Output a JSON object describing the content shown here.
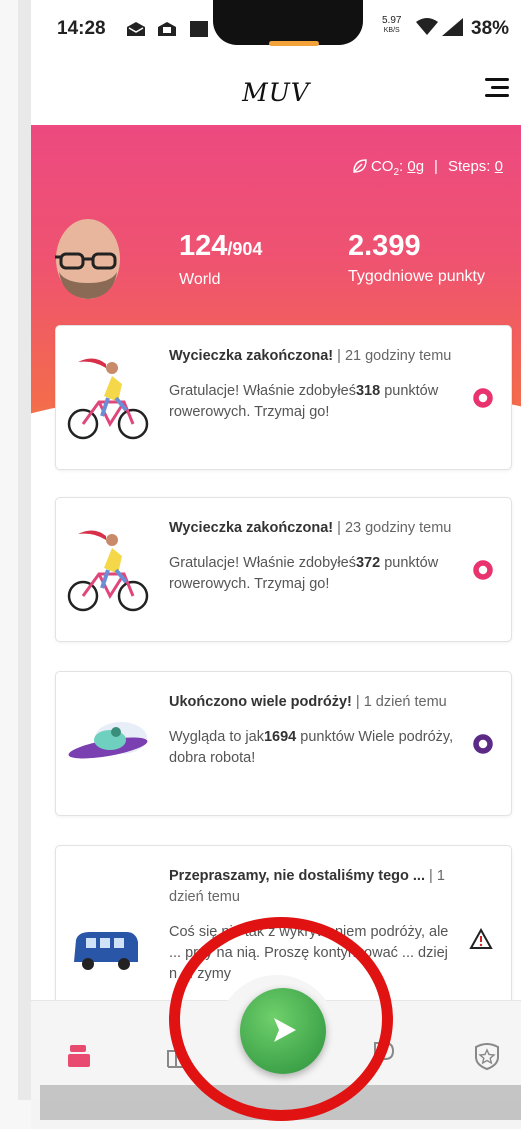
{
  "status_bar": {
    "time": "14:28",
    "speed_value": "5.97",
    "speed_unit": "KB/S",
    "battery": "38%"
  },
  "app": {
    "logo": "MUV"
  },
  "hero": {
    "co2_label": "CO",
    "co2_sub": "2",
    "co2_value": "0g",
    "separator": "|",
    "steps_label": "Steps:",
    "steps_value": "0",
    "rank": "124",
    "rank_total": "/904",
    "rank_label": "World",
    "points": "2.399",
    "points_label": "Tygodniowe punkty"
  },
  "cards": [
    {
      "title": "Wycieczka zakończona!",
      "meta": " | 21 godziny temu",
      "body_pre": "Gratulacje! Właśnie zdobyłeś",
      "body_num": "318",
      "body_post": " punktów rowerowych. Trzymaj go!",
      "indicator": "pink-ring-icon",
      "color": "#e8336e"
    },
    {
      "title": "Wycieczka zakończona!",
      "meta": " | 23 godziny temu",
      "body_pre": "Gratulacje! Właśnie zdobyłeś",
      "body_num": "372",
      "body_post": " punktów rowerowych. Trzymaj go!",
      "indicator": "pink-ring-icon",
      "color": "#e8336e"
    },
    {
      "title": "Ukończono wiele podróży!",
      "meta": " | 1 dzień temu",
      "body_pre": "Wygląda to jak",
      "body_num": "1694",
      "body_post": " punktów Wiele podróży, dobra robota!",
      "indicator": "purple-ring-icon",
      "color": "#5b2a86"
    },
    {
      "title": "Przepraszamy, nie dostaliśmy tego ...",
      "meta": " | 1 dzień temu",
      "body_pre": "Coś się nie tak z wykrywaniem podróży, ale ... przy na nią. Proszę kontynuować ... dziej n ... zymy",
      "body_num": "",
      "body_post": "",
      "indicator": "warning-icon",
      "color": "#222222"
    }
  ],
  "nav": {
    "items": [
      "home-icon",
      "stats-icon",
      "play-icon",
      "parking-icon",
      "badge-star-icon"
    ]
  },
  "colors": {
    "accent_pink": "#ec4a80",
    "accent_orange": "#f48a45",
    "fab_green": "#3fa44a",
    "highlight_red": "#e01212"
  }
}
